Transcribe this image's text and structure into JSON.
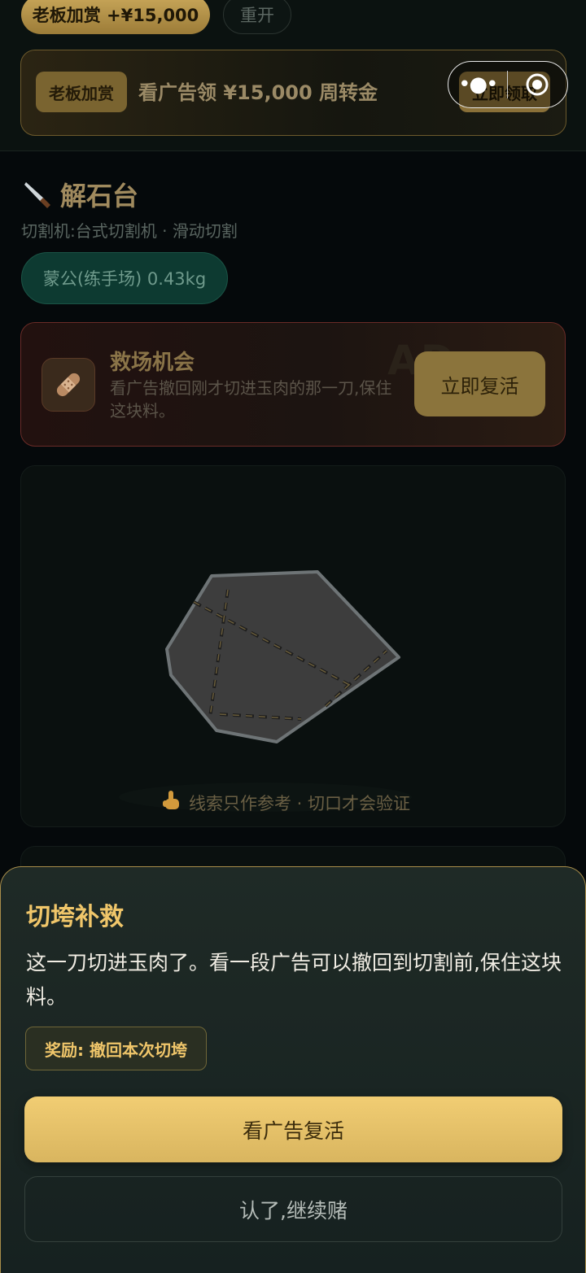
{
  "header": {
    "bonus_pill": "老板加赏 +¥15,000",
    "restart_label": "重开",
    "banner": {
      "badge": "老板加赏",
      "text": "看广告领 ¥15,000 周转金",
      "claim_label": "立即领取"
    }
  },
  "section": {
    "title": "解石台",
    "subtitle": "切割机:台式切割机 · 滑动切割",
    "stone_chip": "蒙公(练手场) 0.43kg"
  },
  "rescue_card": {
    "title": "救场机会",
    "description": "看广告撤回刚才切进玉肉的那一刀,保住这块料。",
    "watermark": "AD",
    "revive_label": "立即复活"
  },
  "board": {
    "hint": "线索只作参考 · 切口才会验证"
  },
  "sheet": {
    "title": "切垮补救",
    "body": "这一刀切进玉肉了。看一段广告可以撤回到切割前,保住这块料。",
    "reward": "奖励: 撤回本次切垮",
    "watch_label": "看广告复活",
    "continue_label": "认了,继续赌"
  },
  "colors": {
    "accent_gold": "#f0c66a",
    "danger_border": "#6a2b27",
    "chip_green": "#0d3a31"
  },
  "icons": [
    "knife-icon",
    "bandage-icon",
    "pointing-hand-icon",
    "more-dots-icon",
    "close-target-icon"
  ]
}
